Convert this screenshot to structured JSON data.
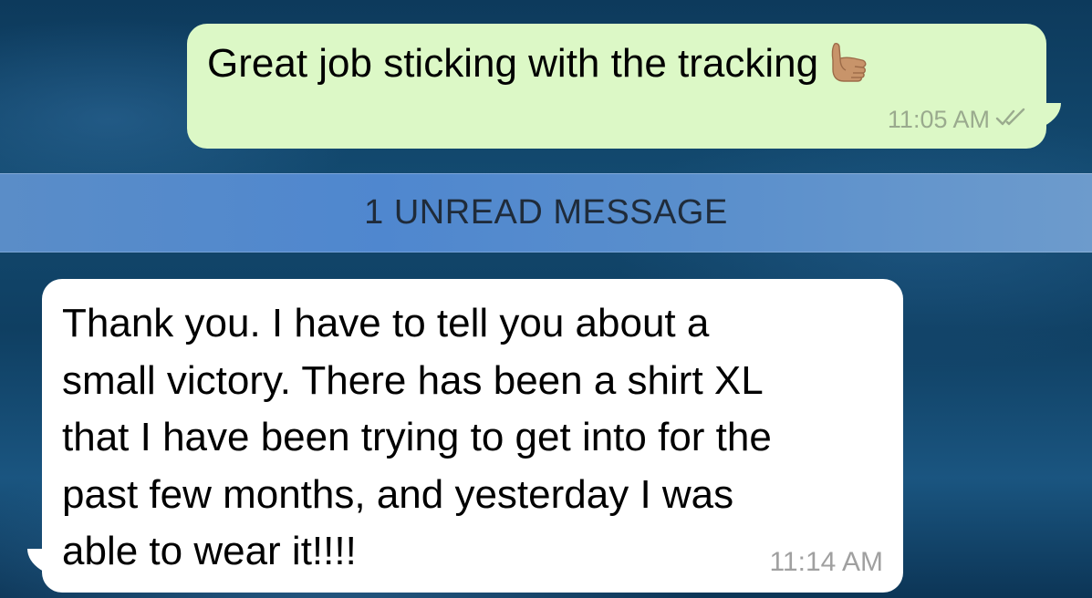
{
  "theme": {
    "outgoing_bubble": "#dcf8c6",
    "incoming_bubble": "#ffffff",
    "banner": "#4f87cf"
  },
  "messages": [
    {
      "direction": "outgoing",
      "text": "Great job sticking with the tracking",
      "emoji": "call-me-hand-icon",
      "time": "11:05 AM",
      "status_icon": "double-check-icon"
    },
    {
      "direction": "incoming",
      "text": "Thank you. I have to tell you about a\nsmall victory.  There has been a shirt XL\nthat I have been trying to get into for the\npast few months, and yesterday I was\nable to wear it!!!!",
      "time": "11:14 AM"
    }
  ],
  "unread_banner": {
    "label": "1 UNREAD MESSAGE"
  }
}
